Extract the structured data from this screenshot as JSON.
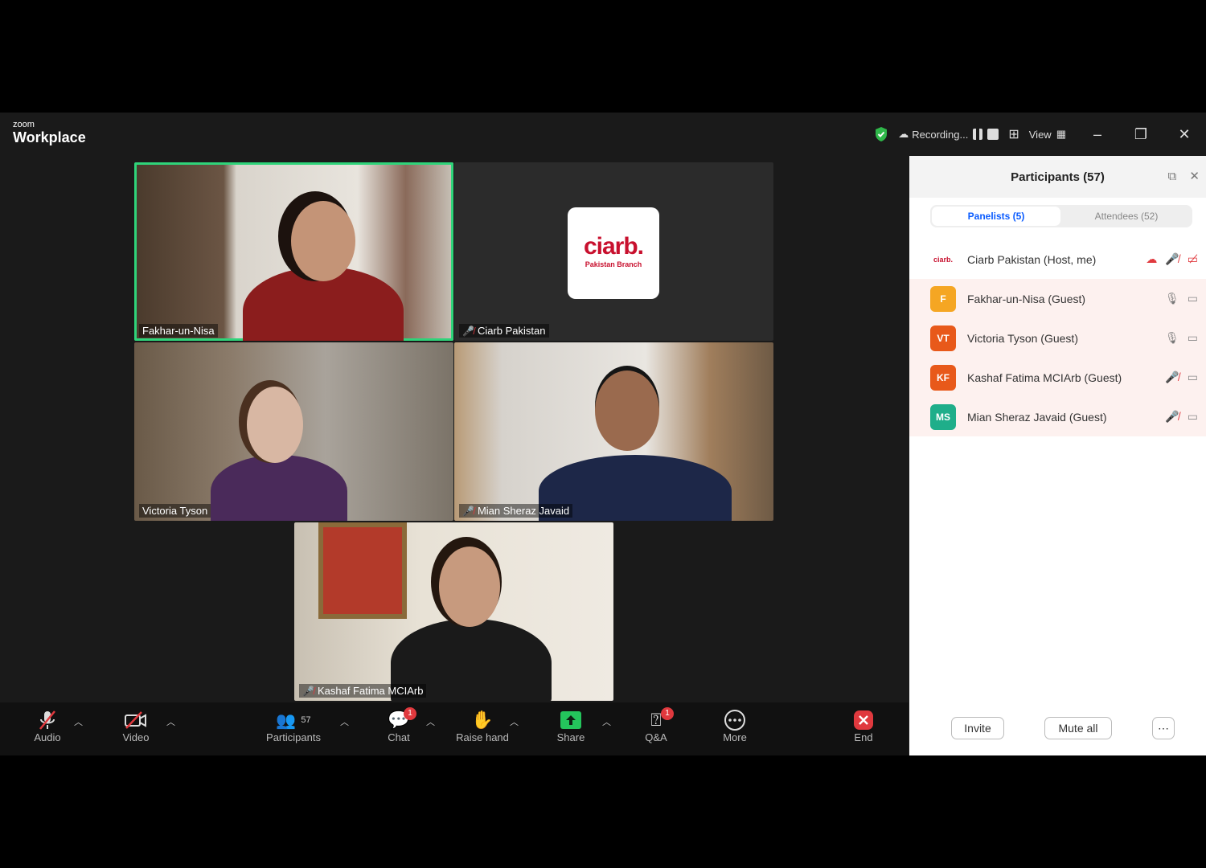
{
  "titlebar": {
    "brand_small": "zoom",
    "brand_big": "Workplace",
    "recording": "Recording...",
    "view": "View"
  },
  "tiles": [
    {
      "name": "Fakhar-un-Nisa",
      "muted": false,
      "active": true
    },
    {
      "name": "Ciarb Pakistan",
      "muted": true,
      "active": false
    },
    {
      "name": "Victoria Tyson",
      "muted": false,
      "active": false
    },
    {
      "name": "Mian Sheraz Javaid",
      "muted": true,
      "active": false
    },
    {
      "name": "Kashaf Fatima MCIArb",
      "muted": true,
      "active": false
    }
  ],
  "logo": {
    "word": "ciarb.",
    "sub": "Pakistan Branch"
  },
  "toolbar": {
    "audio": "Audio",
    "video": "Video",
    "participants": "Participants",
    "participants_count": "57",
    "chat": "Chat",
    "chat_badge": "1",
    "raise_hand": "Raise hand",
    "share": "Share",
    "qa": "Q&A",
    "qa_badge": "1",
    "more": "More",
    "end": "End"
  },
  "panel": {
    "title": "Participants (57)",
    "tab_panelists": "Panelists (5)",
    "tab_attendees": "Attendees (52)",
    "host_logo": "ciarb.",
    "rows": [
      {
        "initials": "",
        "name": "Ciarb Pakistan (Host, me)",
        "color": "#ffffff"
      },
      {
        "initials": "F",
        "name": "Fakhar-un-Nisa (Guest)",
        "color": "#f5a623"
      },
      {
        "initials": "VT",
        "name": "Victoria Tyson (Guest)",
        "color": "#e8591a"
      },
      {
        "initials": "KF",
        "name": "Kashaf Fatima MCIArb (Guest)",
        "color": "#e8591a"
      },
      {
        "initials": "MS",
        "name": "Mian Sheraz Javaid (Guest)",
        "color": "#1fae8a"
      }
    ],
    "invite": "Invite",
    "mute_all": "Mute all"
  }
}
